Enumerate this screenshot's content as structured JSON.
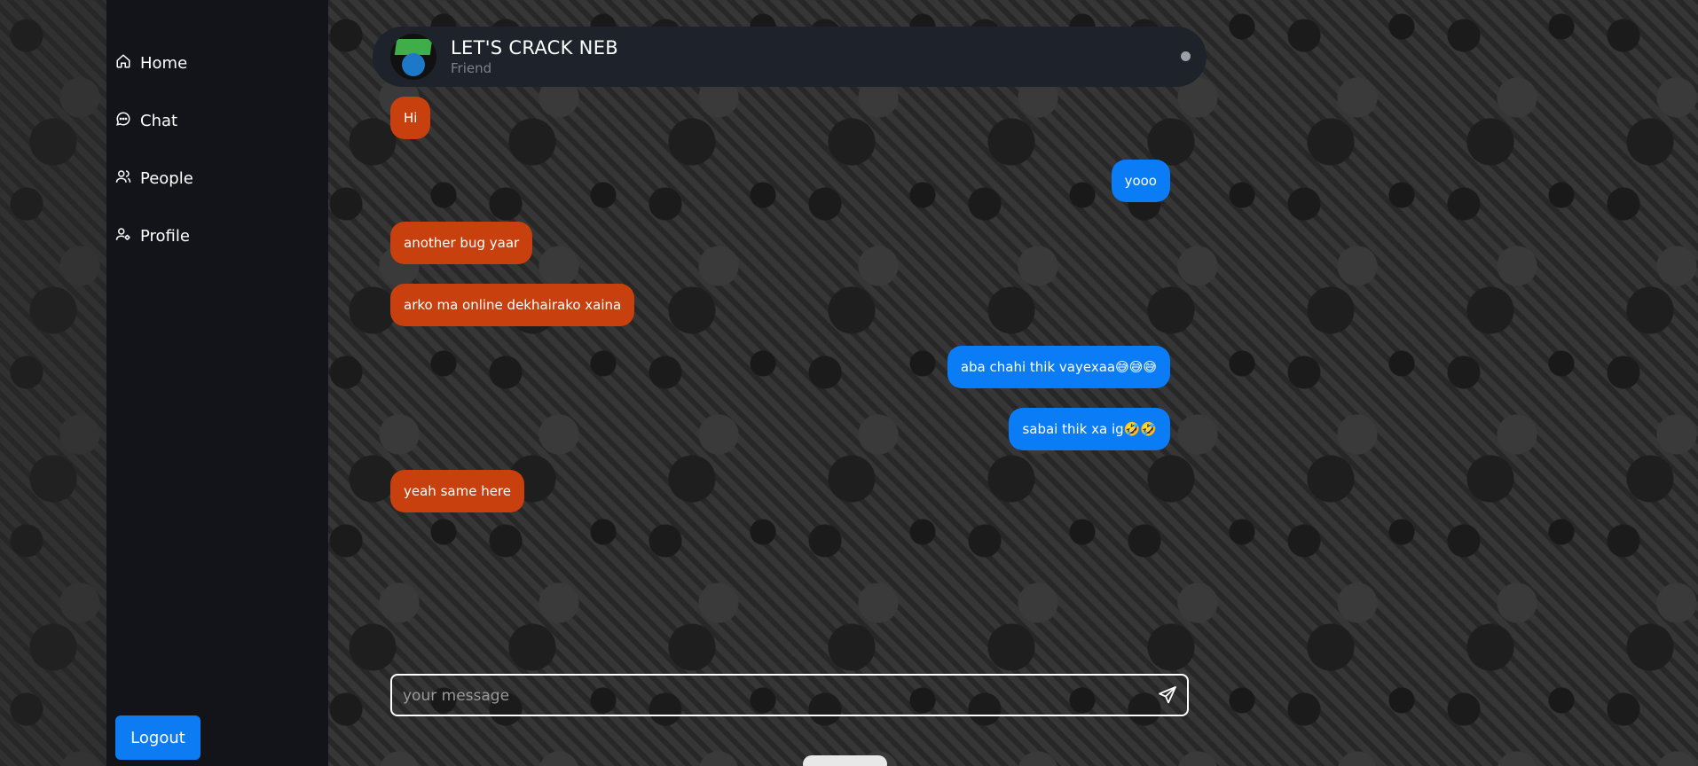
{
  "sidebar": {
    "items": [
      {
        "label": "Home",
        "icon": "home-icon"
      },
      {
        "label": "Chat",
        "icon": "chat-icon"
      },
      {
        "label": "People",
        "icon": "people-icon"
      },
      {
        "label": "Profile",
        "icon": "profile-icon"
      }
    ],
    "logout_label": "Logout"
  },
  "chat": {
    "contact_name": "LET'S CRACK NEB",
    "contact_relation": "Friend",
    "messages": [
      {
        "text": "Hi",
        "from": "other"
      },
      {
        "text": "yooo",
        "from": "me"
      },
      {
        "text": "another bug yaar",
        "from": "other"
      },
      {
        "text": "arko ma online dekhairako xaina",
        "from": "other"
      },
      {
        "text": "aba chahi thik vayexaa😅😅😅",
        "from": "me"
      },
      {
        "text": "sabai thik xa ig🤣🤣",
        "from": "me"
      },
      {
        "text": "yeah same here",
        "from": "other"
      }
    ],
    "input_placeholder": "your message"
  },
  "colors": {
    "received_bubble": "#c8400e",
    "sent_bubble": "#0a7cf5",
    "logout_button": "#0d7cf2",
    "sidebar_bg": "#12141a",
    "header_bg": "#1d222b"
  }
}
